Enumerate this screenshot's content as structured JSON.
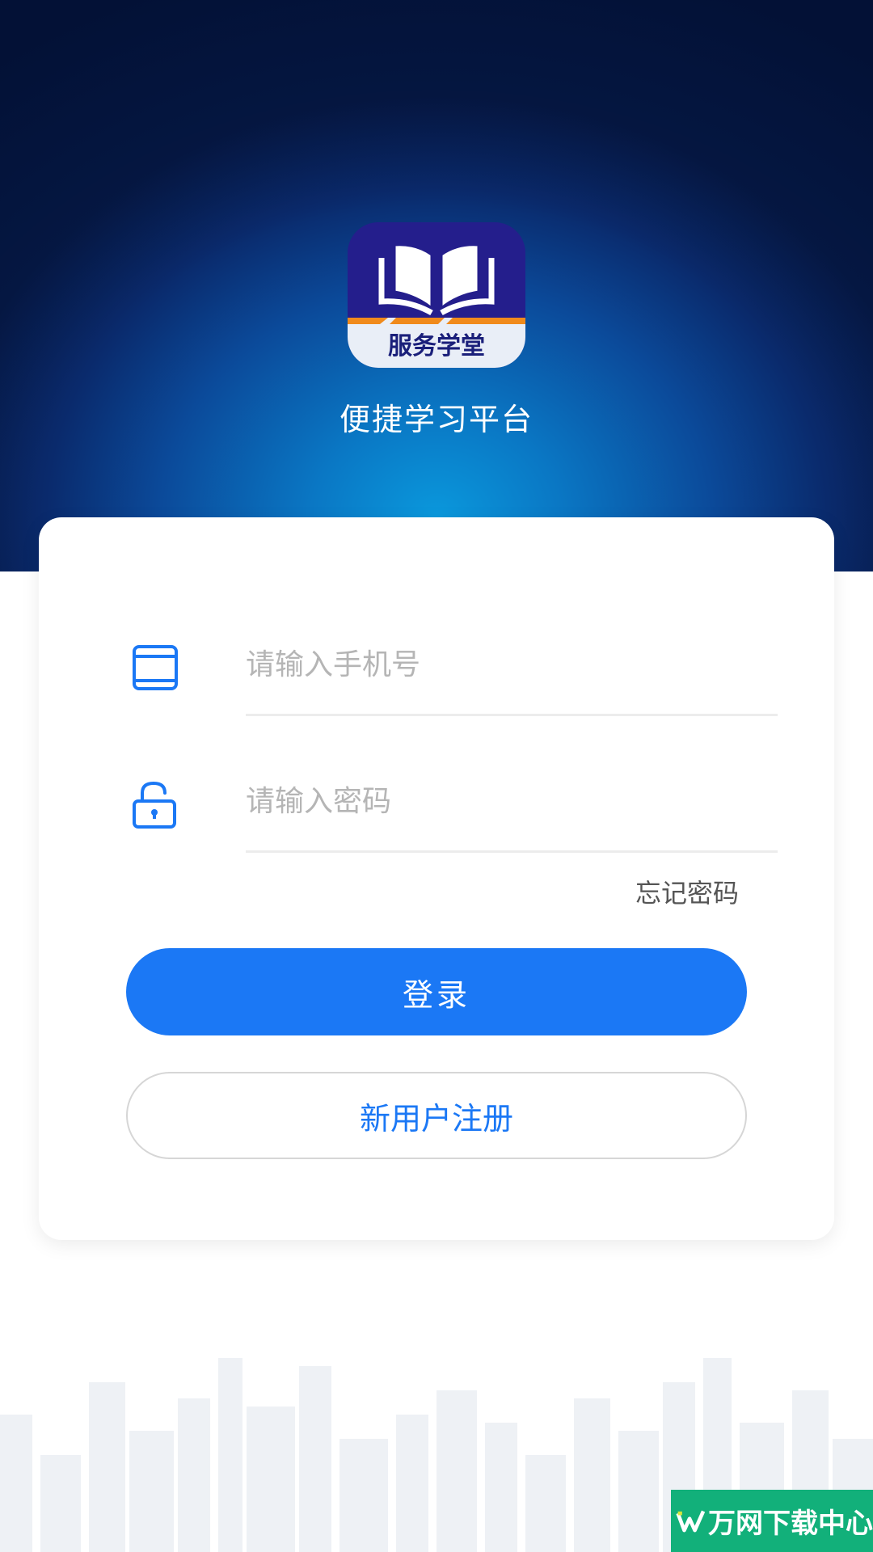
{
  "header": {
    "logo_text": "服务学堂",
    "tagline": "便捷学习平台"
  },
  "login_form": {
    "phone_placeholder": "请输入手机号",
    "password_placeholder": "请输入密码",
    "forgot_password_label": "忘记密码",
    "login_button_label": "登录",
    "register_button_label": "新用户注册"
  },
  "icons": {
    "phone": "tablet-icon",
    "password": "unlock-icon",
    "logo": "book-icon"
  },
  "colors": {
    "primary": "#1b78f5",
    "header_dark": "#061a48",
    "header_light": "#0a98dc",
    "watermark": "#12b07a"
  },
  "watermark": {
    "text": "万网下载中心"
  }
}
